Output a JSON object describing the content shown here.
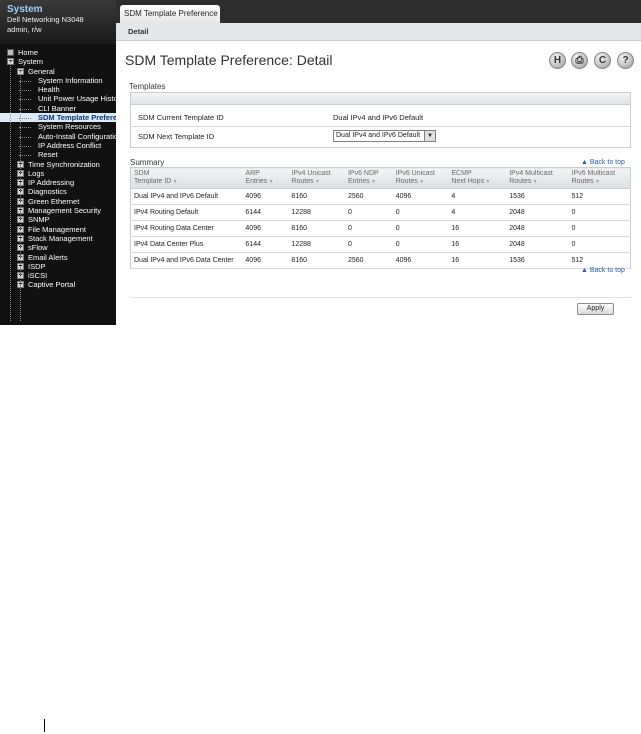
{
  "system": {
    "title": "System",
    "device": "Dell Networking N3048",
    "user": "admin, r/w"
  },
  "tree": [
    {
      "label": "Home",
      "level": 0,
      "toggle": "",
      "icon": "home-icon"
    },
    {
      "label": "System",
      "level": 0,
      "toggle": "−"
    },
    {
      "label": "General",
      "level": 1,
      "toggle": "−"
    },
    {
      "label": "System Information",
      "level": 2,
      "toggle": ""
    },
    {
      "label": "Health",
      "level": 2,
      "toggle": ""
    },
    {
      "label": "Unit Power Usage History",
      "level": 2,
      "toggle": ""
    },
    {
      "label": "CLI Banner",
      "level": 2,
      "toggle": ""
    },
    {
      "label": "SDM Template Preference",
      "level": 2,
      "toggle": "",
      "selected": true
    },
    {
      "label": "System Resources",
      "level": 2,
      "toggle": ""
    },
    {
      "label": "Auto-Install Configuration",
      "level": 2,
      "toggle": ""
    },
    {
      "label": "IP Address Conflict",
      "level": 2,
      "toggle": ""
    },
    {
      "label": "Reset",
      "level": 2,
      "toggle": ""
    },
    {
      "label": "Time Synchronization",
      "level": 1,
      "toggle": "+"
    },
    {
      "label": "Logs",
      "level": 1,
      "toggle": "+"
    },
    {
      "label": "IP Addressing",
      "level": 1,
      "toggle": "+"
    },
    {
      "label": "Diagnostics",
      "level": 1,
      "toggle": "+"
    },
    {
      "label": "Green Ethernet",
      "level": 1,
      "toggle": "+"
    },
    {
      "label": "Management Security",
      "level": 1,
      "toggle": "+"
    },
    {
      "label": "SNMP",
      "level": 1,
      "toggle": "+"
    },
    {
      "label": "File Management",
      "level": 1,
      "toggle": "+"
    },
    {
      "label": "Stack Management",
      "level": 1,
      "toggle": "+"
    },
    {
      "label": "sFlow",
      "level": 1,
      "toggle": "+"
    },
    {
      "label": "Email Alerts",
      "level": 1,
      "toggle": "+"
    },
    {
      "label": "ISDP",
      "level": 1,
      "toggle": "+"
    },
    {
      "label": "iSCSI",
      "level": 1,
      "toggle": "+"
    },
    {
      "label": "Captive Portal",
      "level": 1,
      "toggle": "+"
    }
  ],
  "tab": "SDM Template Preference",
  "subtab": "Detail",
  "page_title": "SDM Template Preference: Detail",
  "toolbar": {
    "save": "H",
    "print": "⎙",
    "refresh": "C",
    "help": "?"
  },
  "templates": {
    "section_label": "Templates",
    "current_label": "SDM Current Template ID",
    "current_value": "Dual IPv4 and IPv6 Default",
    "next_label": "SDM Next Template ID",
    "next_value": "Dual IPv4 and IPv6 Default"
  },
  "summary": {
    "section_label": "Summary",
    "back_to_top": "▲ Back to top",
    "headers": [
      [
        "SDM",
        "Template ID"
      ],
      [
        "ARP",
        "Entries"
      ],
      [
        "IPv4 Unicast",
        "Routes"
      ],
      [
        "IPv6 NDP",
        "Entries"
      ],
      [
        "IPv6 Unicast",
        "Routes"
      ],
      [
        "ECMP",
        "Next Hops"
      ],
      [
        "IPv4 Multicast",
        "Routes"
      ],
      [
        "IPv6 Multicast",
        "Routes"
      ]
    ],
    "rows": [
      [
        "Dual IPv4 and IPv6 Default",
        "4096",
        "8160",
        "2560",
        "4096",
        "4",
        "1536",
        "512"
      ],
      [
        "IPv4 Routing Default",
        "6144",
        "12288",
        "0",
        "0",
        "4",
        "2048",
        "0"
      ],
      [
        "IPv4 Routing Data Center",
        "4096",
        "8160",
        "0",
        "0",
        "16",
        "2048",
        "0"
      ],
      [
        "IPv4 Data Center Plus",
        "6144",
        "12288",
        "0",
        "0",
        "16",
        "2048",
        "0"
      ],
      [
        "Dual IPv4 and IPv6 Data Center",
        "4096",
        "8160",
        "2560",
        "4096",
        "16",
        "1536",
        "512"
      ]
    ]
  },
  "apply_label": "Apply"
}
